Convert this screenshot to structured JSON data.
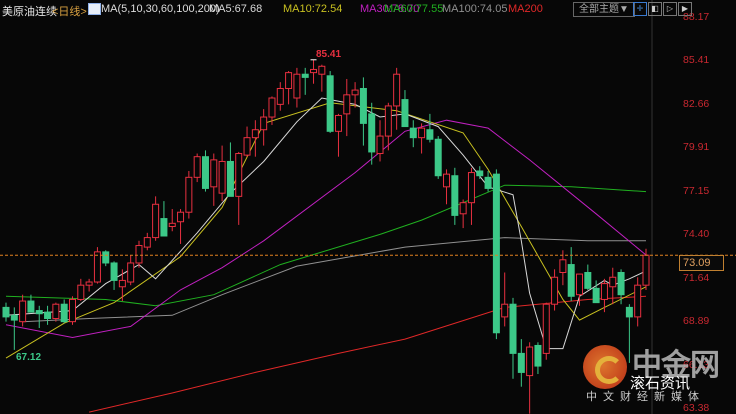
{
  "header": {
    "symbol": "美原油连续",
    "period": "<日线>",
    "ma_params": "MA(5,10,30,60,100,200)",
    "ma_values": [
      {
        "label": "MA5:67.68",
        "color": "#d8d8d8"
      },
      {
        "label": "MA10:72.54",
        "color": "#c8c020"
      },
      {
        "label": "MA30:78.70",
        "color": "#c020c0"
      },
      {
        "label": "MA60:77.55",
        "color": "#20b020"
      },
      {
        "label": "MA100:74.05",
        "color": "#909090"
      },
      {
        "label": "MA200",
        "color": "#e02828"
      }
    ],
    "theme_button": "全部主题▼",
    "toolbar_icons": [
      "crosshair-icon",
      "chart-left-icon",
      "play-icon",
      "step-forward-icon"
    ]
  },
  "price_axis": {
    "labels": [
      "88.17",
      "85.41",
      "82.66",
      "79.91",
      "77.15",
      "74.40",
      "71.64",
      "68.89",
      "66.13",
      "63.38"
    ],
    "current": "73.09"
  },
  "annotations": {
    "high": "85.41",
    "low": "67.12"
  },
  "watermark": {
    "title": "中金网",
    "subtitle": "滚石资讯",
    "slogan": "中文财经新媒体"
  },
  "colors": {
    "up": "#e83040",
    "down": "#3cc888",
    "current_line": "#e08020",
    "background": "#070707"
  },
  "chart_data": {
    "type": "candlestick",
    "ylim": [
      63.38,
      88.17
    ],
    "current_price": 73.09,
    "candles": [
      [
        69.8,
        70.1,
        68.9,
        69.2
      ],
      [
        69.3,
        69.8,
        67.12,
        69.0
      ],
      [
        68.9,
        70.6,
        68.6,
        70.2
      ],
      [
        70.2,
        70.6,
        69.6,
        69.5
      ],
      [
        69.6,
        69.9,
        68.5,
        69.4
      ],
      [
        69.5,
        69.9,
        68.7,
        69.1
      ],
      [
        69.1,
        70.1,
        68.9,
        70.0
      ],
      [
        70.0,
        70.3,
        68.8,
        68.9
      ],
      [
        68.9,
        70.5,
        68.7,
        70.3
      ],
      [
        70.3,
        71.6,
        70.2,
        71.2
      ],
      [
        71.2,
        71.6,
        70.8,
        71.4
      ],
      [
        71.4,
        73.6,
        71.3,
        73.3
      ],
      [
        73.3,
        73.4,
        72.4,
        72.6
      ],
      [
        72.6,
        72.7,
        70.9,
        71.5
      ],
      [
        71.1,
        72.2,
        70.2,
        71.5
      ],
      [
        71.4,
        73.1,
        71.2,
        72.6
      ],
      [
        72.6,
        74.0,
        72.3,
        73.7
      ],
      [
        73.6,
        74.5,
        73.4,
        74.2
      ],
      [
        74.2,
        76.8,
        74.0,
        76.3
      ],
      [
        75.4,
        76.5,
        74.3,
        74.3
      ],
      [
        74.9,
        76.0,
        74.6,
        75.1
      ],
      [
        75.2,
        76.0,
        73.8,
        75.8
      ],
      [
        75.8,
        78.4,
        75.4,
        78.0
      ],
      [
        78.0,
        79.5,
        77.7,
        79.3
      ],
      [
        79.3,
        79.7,
        77.1,
        77.3
      ],
      [
        77.4,
        79.5,
        76.2,
        79.1
      ],
      [
        77.0,
        80.0,
        76.5,
        79.0
      ],
      [
        79.0,
        80.2,
        76.8,
        76.8
      ],
      [
        76.8,
        79.6,
        75.0,
        79.5
      ],
      [
        79.4,
        81.2,
        79.3,
        80.5
      ],
      [
        80.5,
        81.6,
        79.3,
        81.0
      ],
      [
        81.0,
        82.3,
        80.0,
        81.8
      ],
      [
        81.8,
        83.1,
        81.3,
        83.0
      ],
      [
        82.6,
        84.0,
        82.2,
        83.6
      ],
      [
        83.6,
        84.7,
        82.6,
        84.6
      ],
      [
        83.0,
        84.9,
        82.4,
        84.5
      ],
      [
        84.5,
        84.9,
        83.2,
        84.3
      ],
      [
        84.6,
        85.41,
        83.9,
        84.8
      ],
      [
        84.5,
        85.1,
        83.4,
        85.0
      ],
      [
        84.4,
        84.7,
        80.8,
        80.9
      ],
      [
        80.9,
        82.0,
        79.3,
        81.9
      ],
      [
        82.0,
        84.2,
        80.6,
        83.2
      ],
      [
        83.2,
        84.0,
        82.4,
        83.5
      ],
      [
        83.6,
        84.3,
        80.0,
        81.4
      ],
      [
        82.0,
        82.7,
        78.8,
        79.6
      ],
      [
        79.5,
        81.6,
        79.0,
        80.6
      ],
      [
        80.6,
        82.7,
        79.7,
        82.5
      ],
      [
        82.5,
        84.9,
        81.0,
        84.5
      ],
      [
        82.9,
        83.5,
        81.2,
        81.2
      ],
      [
        81.1,
        81.6,
        79.9,
        80.5
      ],
      [
        80.5,
        81.4,
        79.5,
        81.1
      ],
      [
        81.0,
        82.0,
        80.2,
        80.4
      ],
      [
        80.4,
        80.6,
        77.9,
        78.1
      ],
      [
        77.4,
        78.5,
        76.3,
        78.2
      ],
      [
        78.1,
        78.6,
        75.0,
        75.6
      ],
      [
        75.7,
        76.6,
        74.8,
        76.4
      ],
      [
        76.4,
        78.6,
        75.0,
        78.3
      ],
      [
        78.4,
        78.7,
        77.9,
        78.1
      ],
      [
        78.0,
        78.4,
        77.1,
        77.3
      ],
      [
        78.2,
        78.5,
        67.8,
        68.2
      ],
      [
        69.2,
        72.0,
        68.6,
        70.0
      ],
      [
        70.0,
        70.4,
        65.3,
        66.9
      ],
      [
        66.9,
        67.8,
        64.8,
        65.7
      ],
      [
        65.5,
        67.6,
        63.1,
        67.3
      ],
      [
        67.4,
        67.6,
        65.6,
        66.1
      ],
      [
        66.9,
        70.1,
        66.5,
        70.0
      ],
      [
        70.0,
        72.2,
        69.6,
        71.7
      ],
      [
        72.0,
        73.4,
        71.2,
        72.8
      ],
      [
        72.5,
        73.6,
        70.2,
        70.5
      ],
      [
        70.6,
        71.9,
        69.9,
        71.9
      ],
      [
        72.0,
        72.5,
        70.9,
        71.0
      ],
      [
        71.0,
        71.5,
        70.1,
        70.1
      ],
      [
        70.3,
        71.6,
        69.5,
        71.3
      ],
      [
        71.1,
        72.3,
        70.0,
        71.7
      ],
      [
        72.0,
        72.2,
        70.0,
        70.6
      ],
      [
        69.8,
        70.0,
        66.3,
        69.2
      ],
      [
        69.2,
        71.7,
        68.6,
        71.2
      ],
      [
        71.2,
        73.5,
        70.9,
        73.09
      ]
    ],
    "moving_averages": [
      {
        "name": "MA5",
        "color": "#d8d8d8",
        "points": [
          [
            0,
            69.3
          ],
          [
            8,
            69.6
          ],
          [
            12,
            71.3
          ],
          [
            16,
            72.5
          ],
          [
            18,
            71.6
          ],
          [
            23,
            74.5
          ],
          [
            27,
            77.0
          ],
          [
            31,
            79.0
          ],
          [
            35,
            81.5
          ],
          [
            38,
            83.0
          ],
          [
            42,
            82.6
          ],
          [
            45,
            81.8
          ],
          [
            48,
            82.0
          ],
          [
            52,
            81.2
          ],
          [
            55,
            79.4
          ],
          [
            58,
            77.4
          ],
          [
            61,
            76.9
          ],
          [
            62,
            74.0
          ],
          [
            63,
            70.7
          ],
          [
            65,
            67.2
          ],
          [
            67,
            67.2
          ],
          [
            69,
            70.5
          ],
          [
            72,
            71.5
          ],
          [
            73,
            71.2
          ],
          [
            75,
            71.6
          ],
          [
            77,
            72.1
          ]
        ]
      },
      {
        "name": "MA10",
        "color": "#c8c020",
        "points": [
          [
            0,
            66.6
          ],
          [
            7,
            68.8
          ],
          [
            13,
            70.1
          ],
          [
            21,
            73.0
          ],
          [
            26,
            76.1
          ],
          [
            31,
            81.4
          ],
          [
            39,
            82.7
          ],
          [
            47,
            82.2
          ],
          [
            55,
            80.8
          ],
          [
            58,
            78.5
          ],
          [
            62,
            74.9
          ],
          [
            67,
            70.3
          ],
          [
            69,
            69.0
          ],
          [
            72,
            69.8
          ],
          [
            77,
            71.1
          ]
        ]
      },
      {
        "name": "MA30",
        "color": "#c020c0",
        "points": [
          [
            0,
            68.7
          ],
          [
            8,
            67.9
          ],
          [
            15,
            68.6
          ],
          [
            21,
            70.9
          ],
          [
            26,
            72.3
          ],
          [
            31,
            74.0
          ],
          [
            42,
            78.3
          ],
          [
            48,
            80.9
          ],
          [
            53,
            81.6
          ],
          [
            58,
            81.1
          ],
          [
            63,
            79.1
          ],
          [
            71,
            75.7
          ],
          [
            77,
            73.1
          ]
        ]
      },
      {
        "name": "MA60",
        "color": "#20b020",
        "points": [
          [
            0,
            70.5
          ],
          [
            12,
            70.3
          ],
          [
            18,
            69.9
          ],
          [
            25,
            70.6
          ],
          [
            33,
            72.5
          ],
          [
            45,
            74.4
          ],
          [
            50,
            75.3
          ],
          [
            60,
            77.5
          ],
          [
            68,
            77.4
          ],
          [
            77,
            77.1
          ]
        ]
      },
      {
        "name": "MA100",
        "color": "#909090",
        "points": [
          [
            2,
            68.9
          ],
          [
            10,
            69.1
          ],
          [
            20,
            69.3
          ],
          [
            26,
            70.6
          ],
          [
            35,
            72.4
          ],
          [
            48,
            73.6
          ],
          [
            60,
            74.2
          ],
          [
            70,
            74.0
          ],
          [
            77,
            74.0
          ]
        ]
      },
      {
        "name": "MA200",
        "color": "#e02828",
        "points": [
          [
            10,
            63.2
          ],
          [
            20,
            64.4
          ],
          [
            30,
            65.7
          ],
          [
            40,
            66.9
          ],
          [
            48,
            67.8
          ],
          [
            60,
            69.8
          ],
          [
            70,
            70.3
          ],
          [
            77,
            70.5
          ]
        ]
      }
    ]
  }
}
